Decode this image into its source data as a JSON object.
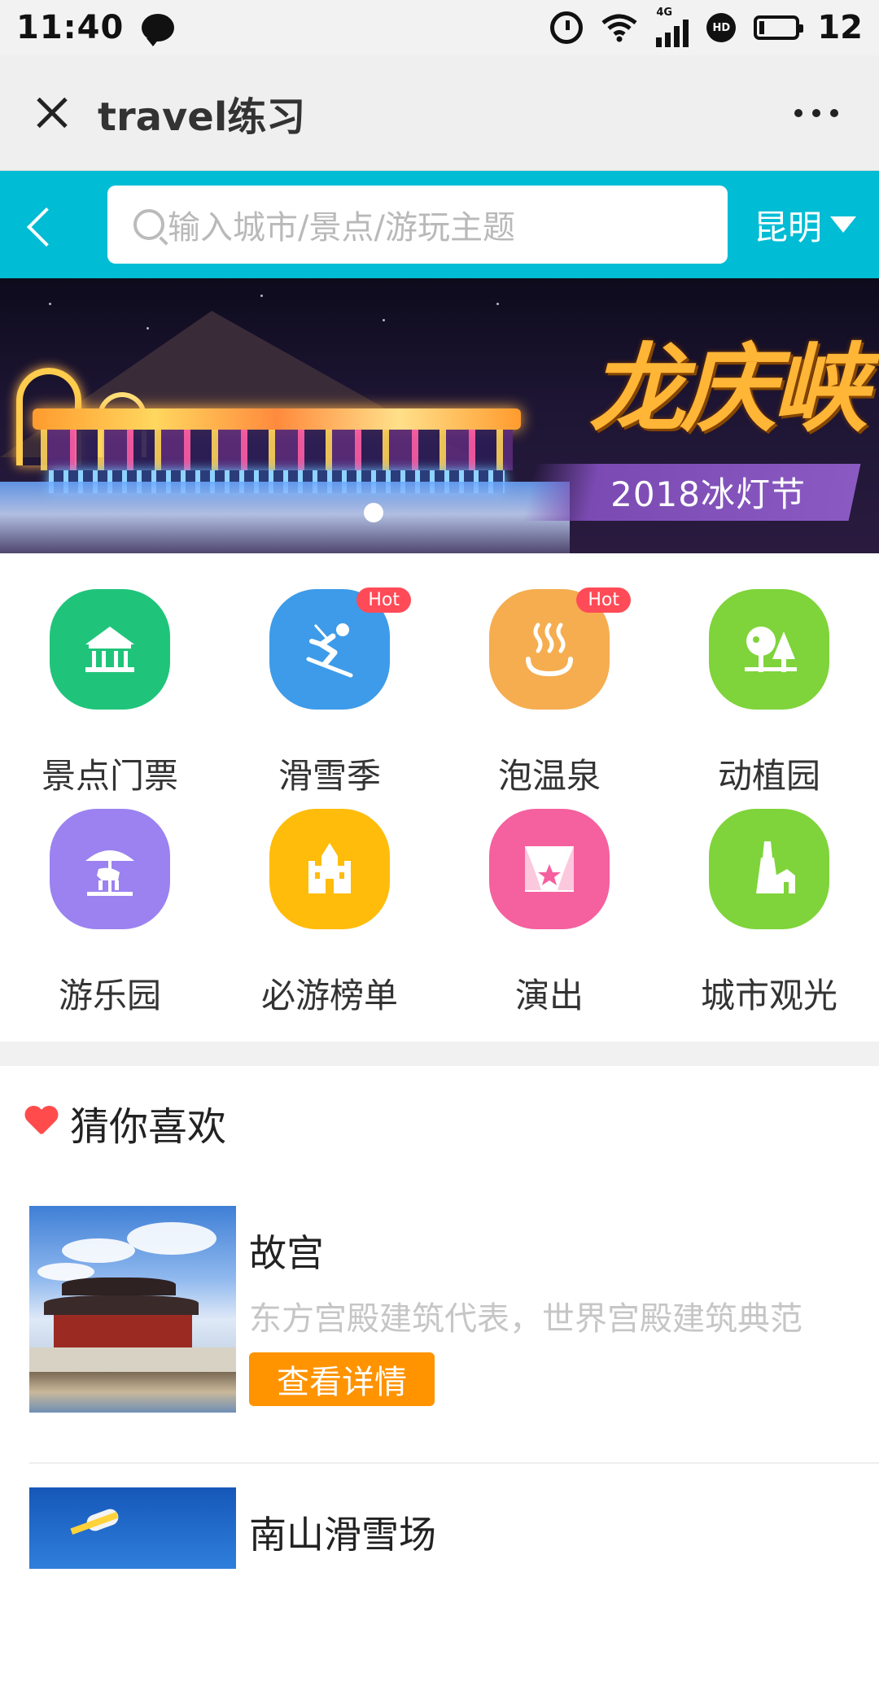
{
  "status_bar": {
    "time": "11:40",
    "network": "4G",
    "battery": "12"
  },
  "titlebar": {
    "title": "travel练习"
  },
  "search": {
    "placeholder": "输入城市/景点/游玩主题",
    "city": "昆明"
  },
  "banner": {
    "brand": "龙庆峡",
    "subtitle": "2018冰灯节"
  },
  "categories": [
    {
      "label": "景点门票",
      "icon": "pavilion-icon",
      "color": "#1fc47a",
      "hot": ""
    },
    {
      "label": "滑雪季",
      "icon": "skier-icon",
      "color": "#3d9be9",
      "hot": "Hot"
    },
    {
      "label": "泡温泉",
      "icon": "hot-spring-icon",
      "color": "#f5ad4f",
      "hot": "Hot"
    },
    {
      "label": "动植园",
      "icon": "trees-icon",
      "color": "#7ed43a",
      "hot": ""
    },
    {
      "label": "游乐园",
      "icon": "carousel-icon",
      "color": "#9b82f0",
      "hot": ""
    },
    {
      "label": "必游榜单",
      "icon": "castle-icon",
      "color": "#ffbc0a",
      "hot": ""
    },
    {
      "label": "演出",
      "icon": "stage-icon",
      "color": "#f5609f",
      "hot": ""
    },
    {
      "label": "城市观光",
      "icon": "tower-icon",
      "color": "#7ed43a",
      "hot": ""
    }
  ],
  "recommend": {
    "title": "猜你喜欢",
    "items": [
      {
        "name": "故宫",
        "desc": "东方宫殿建筑代表，世界宫殿建筑典范",
        "button": "查看详情"
      },
      {
        "name": "南山滑雪场",
        "desc": "",
        "button": ""
      }
    ]
  },
  "colors": {
    "search_bar": "#00bcd4",
    "button": "#ff9300",
    "heart": "#ff4b4b"
  }
}
